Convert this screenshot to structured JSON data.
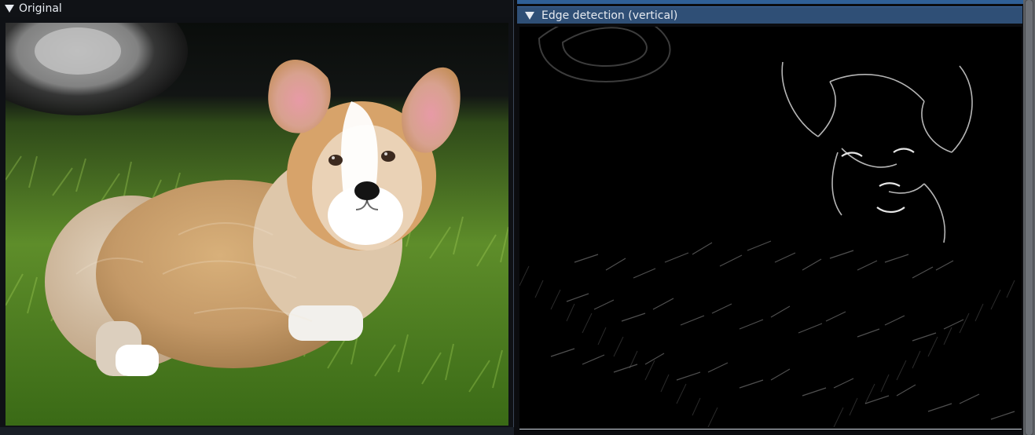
{
  "windows": {
    "left": {
      "title": "Original",
      "image_alt": "Corgi puppy on grass"
    },
    "right": {
      "title": "Edge detection (vertical)",
      "image_alt": "Vertical edge detection result"
    }
  },
  "colors": {
    "active_title_bg": "#2f4f76",
    "inactive_title_bg": "#101216",
    "text": "#e7ebf1"
  }
}
